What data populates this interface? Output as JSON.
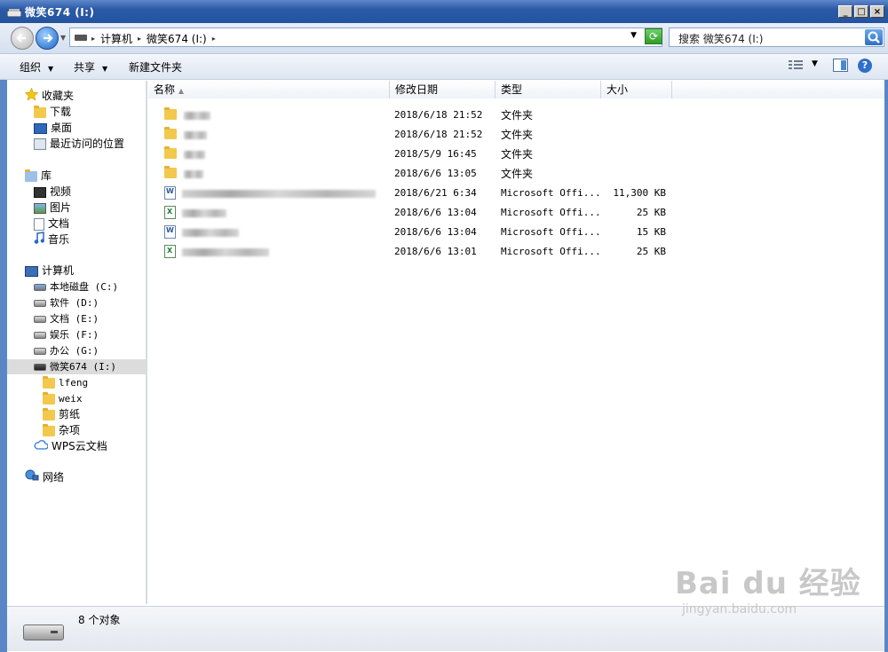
{
  "window": {
    "title": "微笑674 (I:)",
    "btn_min": "_",
    "btn_max": "□",
    "btn_close": "×"
  },
  "navbar": {
    "breadcrumbs": [
      "计算机",
      "微笑674 (I:)"
    ],
    "search_placeholder": "搜索 微笑674 (I:)"
  },
  "toolbar": {
    "organize": "组织",
    "share": "共享",
    "new_folder": "新建文件夹"
  },
  "sidebar": {
    "favorites": {
      "label": "收藏夹",
      "items": [
        "下载",
        "桌面",
        "最近访问的位置"
      ]
    },
    "libraries": {
      "label": "库",
      "items": [
        "视频",
        "图片",
        "文档",
        "音乐"
      ]
    },
    "computer": {
      "label": "计算机",
      "drives": [
        "本地磁盘 (C:)",
        "软件 (D:)",
        "文档 (E:)",
        "娱乐 (F:)",
        "办公 (G:)",
        "微笑674 (I:)"
      ],
      "subfolders": [
        "lfeng",
        "weix",
        "剪纸",
        "杂项"
      ],
      "cloud": "WPS云文档"
    },
    "network": "网络"
  },
  "columns": [
    "名称",
    "修改日期",
    "类型",
    "大小"
  ],
  "files": [
    {
      "kind": "folder",
      "date": "2018/6/18 21:52",
      "type": "文件夹",
      "size": ""
    },
    {
      "kind": "folder",
      "date": "2018/6/18 21:52",
      "type": "文件夹",
      "size": ""
    },
    {
      "kind": "folder",
      "date": "2018/5/9 16:45",
      "type": "文件夹",
      "size": ""
    },
    {
      "kind": "folder",
      "date": "2018/6/6 13:05",
      "type": "文件夹",
      "size": ""
    },
    {
      "kind": "word",
      "date": "2018/6/21 6:34",
      "type": "Microsoft Offi...",
      "size": "11,300 KB"
    },
    {
      "kind": "excel",
      "date": "2018/6/6 13:04",
      "type": "Microsoft Offi...",
      "size": "25 KB"
    },
    {
      "kind": "word",
      "date": "2018/6/6 13:04",
      "type": "Microsoft Offi...",
      "size": "15 KB"
    },
    {
      "kind": "excel",
      "date": "2018/6/6 13:01",
      "type": "Microsoft Offi...",
      "size": "25 KB"
    }
  ],
  "status": {
    "count": "8 个对象"
  },
  "watermark": {
    "brand": "Bai du 经验",
    "url": "jingyan.baidu.com"
  }
}
